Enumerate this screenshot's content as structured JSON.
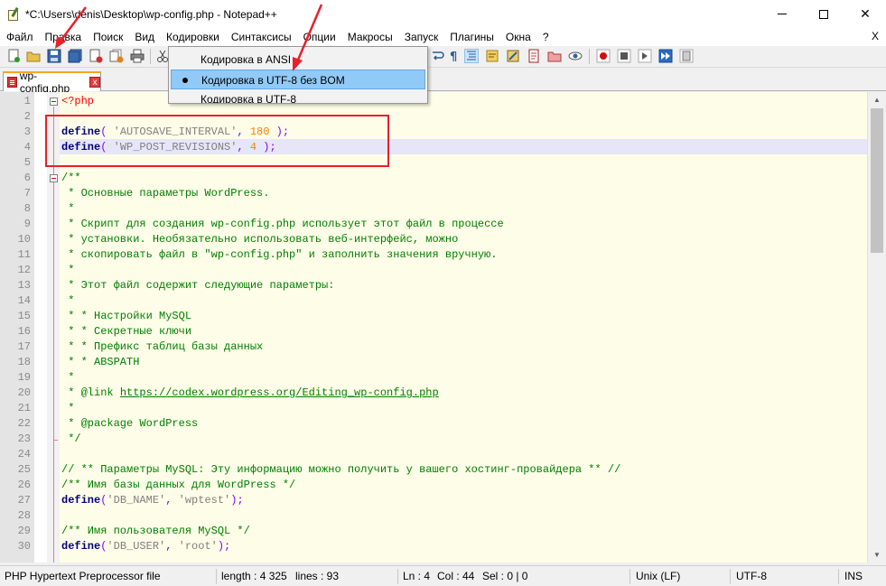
{
  "window": {
    "title": "*C:\\Users\\denis\\Desktop\\wp-config.php - Notepad++",
    "close_glyph": "✕",
    "menu_close": "X"
  },
  "menu": [
    "Файл",
    "Правка",
    "Поиск",
    "Вид",
    "Кодировки",
    "Синтаксисы",
    "Опции",
    "Макросы",
    "Запуск",
    "Плагины",
    "Окна",
    "?"
  ],
  "tab": {
    "label": "wp-config.php",
    "close_glyph": "x"
  },
  "encoding_menu": {
    "items": [
      {
        "label": "Кодировка в ANSI",
        "selected": false
      },
      {
        "label": "Кодировка в UTF-8 без BOM",
        "selected": true
      },
      {
        "label": "Кодировка в UTF-8",
        "selected": false
      }
    ]
  },
  "code": {
    "current_line": 4,
    "lines": [
      {
        "n": "1",
        "t": [
          {
            "c": "php",
            "v": "<?php"
          }
        ]
      },
      {
        "n": "2",
        "t": []
      },
      {
        "n": "3",
        "t": [
          {
            "c": "kw",
            "v": "define"
          },
          {
            "c": "op",
            "v": "( "
          },
          {
            "c": "str",
            "v": "'AUTOSAVE_INTERVAL'"
          },
          {
            "c": "op",
            "v": ", "
          },
          {
            "c": "num",
            "v": "180"
          },
          {
            "c": "op",
            "v": " );"
          }
        ]
      },
      {
        "n": "4",
        "t": [
          {
            "c": "kw",
            "v": "define"
          },
          {
            "c": "op",
            "v": "( "
          },
          {
            "c": "str",
            "v": "'WP_POST_REVISIONS'"
          },
          {
            "c": "op",
            "v": ", "
          },
          {
            "c": "num",
            "v": "4"
          },
          {
            "c": "op",
            "v": " );"
          }
        ]
      },
      {
        "n": "5",
        "t": []
      },
      {
        "n": "6",
        "t": [
          {
            "c": "cm",
            "v": "/**"
          }
        ]
      },
      {
        "n": "7",
        "t": [
          {
            "c": "cm",
            "v": " * Основные параметры WordPress."
          }
        ]
      },
      {
        "n": "8",
        "t": [
          {
            "c": "cm",
            "v": " *"
          }
        ]
      },
      {
        "n": "9",
        "t": [
          {
            "c": "cm",
            "v": " * Скрипт для создания wp-config.php использует этот файл в процессе"
          }
        ]
      },
      {
        "n": "10",
        "t": [
          {
            "c": "cm",
            "v": " * установки. Необязательно использовать веб-интерфейс, можно"
          }
        ]
      },
      {
        "n": "11",
        "t": [
          {
            "c": "cm",
            "v": " * скопировать файл в \"wp-config.php\" и заполнить значения вручную."
          }
        ]
      },
      {
        "n": "12",
        "t": [
          {
            "c": "cm",
            "v": " *"
          }
        ]
      },
      {
        "n": "13",
        "t": [
          {
            "c": "cm",
            "v": " * Этот файл содержит следующие параметры:"
          }
        ]
      },
      {
        "n": "14",
        "t": [
          {
            "c": "cm",
            "v": " *"
          }
        ]
      },
      {
        "n": "15",
        "t": [
          {
            "c": "cm",
            "v": " * * Настройки MySQL"
          }
        ]
      },
      {
        "n": "16",
        "t": [
          {
            "c": "cm",
            "v": " * * Секретные ключи"
          }
        ]
      },
      {
        "n": "17",
        "t": [
          {
            "c": "cm",
            "v": " * * Префикс таблиц базы данных"
          }
        ]
      },
      {
        "n": "18",
        "t": [
          {
            "c": "cm",
            "v": " * * ABSPATH"
          }
        ]
      },
      {
        "n": "19",
        "t": [
          {
            "c": "cm",
            "v": " *"
          }
        ]
      },
      {
        "n": "20",
        "t": [
          {
            "c": "cm",
            "v": " * @link "
          },
          {
            "c": "lnk",
            "v": "https://codex.wordpress.org/Editing_wp-config.php"
          }
        ]
      },
      {
        "n": "21",
        "t": [
          {
            "c": "cm",
            "v": " *"
          }
        ]
      },
      {
        "n": "22",
        "t": [
          {
            "c": "cm",
            "v": " * @package WordPress"
          }
        ]
      },
      {
        "n": "23",
        "t": [
          {
            "c": "cm",
            "v": " */"
          }
        ]
      },
      {
        "n": "24",
        "t": []
      },
      {
        "n": "25",
        "t": [
          {
            "c": "cm",
            "v": "// ** Параметры MySQL: Эту информацию можно получить у вашего хостинг-провайдера ** //"
          }
        ]
      },
      {
        "n": "26",
        "t": [
          {
            "c": "cm",
            "v": "/** Имя базы данных для WordPress */"
          }
        ]
      },
      {
        "n": "27",
        "t": [
          {
            "c": "kw",
            "v": "define"
          },
          {
            "c": "op",
            "v": "("
          },
          {
            "c": "str",
            "v": "'DB_NAME'"
          },
          {
            "c": "op",
            "v": ", "
          },
          {
            "c": "str",
            "v": "'wptest'"
          },
          {
            "c": "op",
            "v": ");"
          }
        ]
      },
      {
        "n": "28",
        "t": []
      },
      {
        "n": "29",
        "t": [
          {
            "c": "cm",
            "v": "/** Имя пользователя MySQL */"
          }
        ]
      },
      {
        "n": "30",
        "t": [
          {
            "c": "kw",
            "v": "define"
          },
          {
            "c": "op",
            "v": "("
          },
          {
            "c": "str",
            "v": "'DB_USER'"
          },
          {
            "c": "op",
            "v": ", "
          },
          {
            "c": "str",
            "v": "'root'"
          },
          {
            "c": "op",
            "v": ");"
          }
        ]
      }
    ]
  },
  "statusbar": {
    "file_type": "PHP Hypertext Preprocessor file",
    "length": "length : 4 325",
    "lines": "lines : 93",
    "ln": "Ln : 4",
    "col": "Col : 44",
    "sel": "Sel : 0 | 0",
    "eol": "Unix (LF)",
    "encoding": "UTF-8",
    "ins": "INS"
  },
  "colors": {
    "annotation": "#e8202a",
    "keyword": "#000080",
    "string": "#808080",
    "number": "#ff8000",
    "comment": "#008000",
    "selection": "#91c9f7"
  }
}
